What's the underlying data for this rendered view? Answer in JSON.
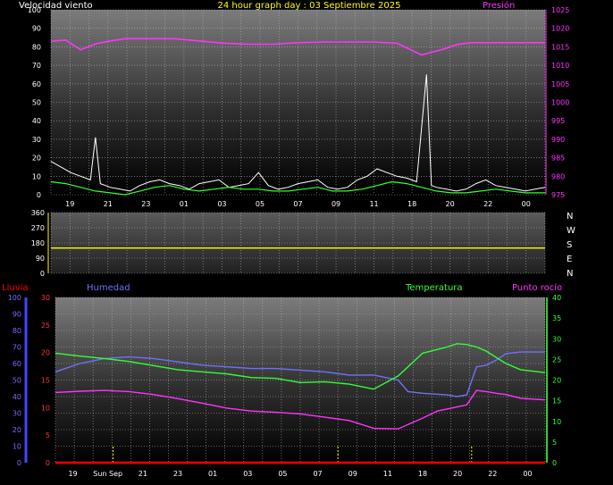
{
  "colors": {
    "background": "#000000",
    "wind_label": "#ffffff",
    "title": "#ffff00",
    "pressure": "#ff33ff",
    "gust": "#ffffff",
    "wind_avg": "#33ff33",
    "direction_line": "#ffff00",
    "rain": "#ff0000",
    "humidity": "#7070ff",
    "temperature": "#33ff33",
    "dewpoint": "#ff33ff",
    "axis_rain": "#4444ff",
    "axis_temp": "#33cc33"
  },
  "header": {
    "wind_label": "Velocidad viento",
    "title": "24 hour graph day : 03 Septiembre 2025",
    "pressure_label": "Presión"
  },
  "compass": [
    "N",
    "W",
    "S",
    "E",
    "N"
  ],
  "bottom_labels": {
    "rain": "Lluvia",
    "humidity": "Humedad",
    "temperature": "Temperatura",
    "dewpoint": "Punto rocío"
  },
  "chart_data": [
    {
      "type": "line",
      "name": "wind_pressure",
      "x_tick_labels": [
        "19",
        "21",
        "23",
        "01",
        "03",
        "05",
        "07",
        "09",
        "11",
        "18",
        "20",
        "22",
        "00"
      ],
      "y_left_ticks": [
        "0",
        "10",
        "20",
        "30",
        "40",
        "50",
        "60",
        "70",
        "80",
        "90",
        "100"
      ],
      "y_right_ticks": [
        "975",
        "980",
        "985",
        "990",
        "995",
        "1000",
        "1005",
        "1010",
        "1015",
        "1020",
        "1025"
      ],
      "ylim_left": [
        0,
        100
      ],
      "ylim_right": [
        975,
        1025
      ],
      "series": [
        {
          "key": "pressure",
          "axis": "right",
          "x": [
            0,
            0.03,
            0.06,
            0.09,
            0.12,
            0.15,
            0.2,
            0.25,
            0.3,
            0.35,
            0.4,
            0.45,
            0.5,
            0.55,
            0.6,
            0.65,
            0.7,
            0.75,
            0.8,
            0.82,
            0.85,
            0.9,
            0.95,
            1
          ],
          "values": [
            1016.5,
            1016.8,
            1014.2,
            1015.8,
            1016.6,
            1017.2,
            1017.2,
            1017.2,
            1016.6,
            1016.0,
            1015.7,
            1015.7,
            1016.1,
            1016.3,
            1016.3,
            1016.3,
            1016.0,
            1012.8,
            1014.6,
            1015.6,
            1016.1,
            1016.1,
            1016.1,
            1016.1
          ]
        },
        {
          "key": "gust",
          "axis": "left",
          "x": [
            0,
            0.02,
            0.04,
            0.06,
            0.08,
            0.09,
            0.1,
            0.12,
            0.14,
            0.16,
            0.18,
            0.2,
            0.22,
            0.24,
            0.26,
            0.28,
            0.3,
            0.32,
            0.34,
            0.36,
            0.38,
            0.4,
            0.42,
            0.44,
            0.46,
            0.48,
            0.5,
            0.52,
            0.54,
            0.56,
            0.58,
            0.6,
            0.62,
            0.64,
            0.66,
            0.68,
            0.7,
            0.72,
            0.74,
            0.76,
            0.77,
            0.78,
            0.8,
            0.82,
            0.84,
            0.86,
            0.88,
            0.9,
            0.92,
            0.94,
            0.96,
            0.98,
            1
          ],
          "values": [
            18,
            15,
            12,
            10,
            8,
            31,
            6,
            4,
            3,
            2,
            5,
            7,
            8,
            6,
            5,
            3,
            6,
            7,
            8,
            4,
            5,
            6,
            12,
            5,
            3,
            4,
            6,
            7,
            8,
            4,
            3,
            4,
            8,
            10,
            14,
            12,
            10,
            9,
            7,
            65,
            5,
            4,
            3,
            2,
            3,
            6,
            8,
            5,
            4,
            3,
            2,
            3,
            4
          ]
        },
        {
          "key": "wind_avg",
          "axis": "left",
          "x": [
            0,
            0.03,
            0.06,
            0.09,
            0.12,
            0.15,
            0.18,
            0.21,
            0.24,
            0.27,
            0.3,
            0.33,
            0.36,
            0.39,
            0.42,
            0.45,
            0.48,
            0.51,
            0.54,
            0.57,
            0.6,
            0.63,
            0.66,
            0.69,
            0.72,
            0.75,
            0.78,
            0.81,
            0.84,
            0.87,
            0.9,
            0.93,
            0.96,
            1
          ],
          "values": [
            7,
            6,
            4,
            2,
            1,
            0,
            2,
            4,
            5,
            3,
            2,
            3,
            4,
            3,
            3,
            2,
            2,
            3,
            4,
            2,
            2,
            3,
            5,
            7,
            6,
            4,
            2,
            1,
            1,
            2,
            3,
            2,
            1,
            1
          ]
        }
      ]
    },
    {
      "type": "line",
      "name": "wind_direction",
      "y_ticks": [
        "0",
        "90",
        "180",
        "270",
        "360"
      ],
      "ylim": [
        0,
        360
      ],
      "series": [
        {
          "key": "direction",
          "x": [
            0,
            1
          ],
          "values": [
            150,
            150
          ]
        }
      ]
    },
    {
      "type": "line",
      "name": "temp_hum",
      "x_tick_labels": [
        "19",
        "Sun Sep",
        "21",
        "23",
        "01",
        "03",
        "05",
        "07",
        "09",
        "11",
        "18",
        "20",
        "22",
        "00"
      ],
      "y_rain_ticks": [
        "0",
        "5",
        "10",
        "15",
        "20",
        "25",
        "30"
      ],
      "y_humidity_ticks": [
        "0",
        "10",
        "20",
        "30",
        "40",
        "50",
        "60",
        "70",
        "80",
        "90",
        "100"
      ],
      "y_temp_ticks": [
        "0",
        "5",
        "10",
        "15",
        "20",
        "25",
        "30",
        "35",
        "40"
      ],
      "ylim_rain": [
        0,
        30
      ],
      "ylim_humidity": [
        0,
        100
      ],
      "ylim_temp": [
        0,
        40
      ],
      "series": [
        {
          "key": "humidity",
          "axis": "humidity",
          "x": [
            0,
            0.05,
            0.1,
            0.15,
            0.2,
            0.25,
            0.3,
            0.35,
            0.4,
            0.45,
            0.5,
            0.55,
            0.6,
            0.65,
            0.7,
            0.72,
            0.75,
            0.8,
            0.82,
            0.84,
            0.86,
            0.88,
            0.9,
            0.92,
            0.95,
            1
          ],
          "values": [
            55,
            60,
            63,
            64,
            63,
            61,
            59,
            58,
            57,
            57,
            56,
            55,
            53,
            53,
            50,
            43,
            42,
            41,
            40,
            41,
            58,
            59,
            62,
            66,
            67,
            67
          ]
        },
        {
          "key": "temperature",
          "axis": "temp",
          "x": [
            0,
            0.05,
            0.1,
            0.15,
            0.2,
            0.25,
            0.3,
            0.35,
            0.4,
            0.45,
            0.5,
            0.55,
            0.6,
            0.65,
            0.7,
            0.75,
            0.8,
            0.82,
            0.84,
            0.86,
            0.88,
            0.9,
            0.92,
            0.95,
            1
          ],
          "values": [
            26.5,
            25.8,
            25.2,
            24.5,
            23.5,
            22.5,
            22,
            21.5,
            20.6,
            20.4,
            19.4,
            19.6,
            19,
            17.8,
            21,
            26.5,
            28,
            28.8,
            28.6,
            28,
            27,
            25.5,
            24,
            22.5,
            21.8
          ]
        },
        {
          "key": "dewpoint",
          "axis": "temp",
          "x": [
            0,
            0.05,
            0.1,
            0.15,
            0.2,
            0.25,
            0.3,
            0.35,
            0.4,
            0.45,
            0.5,
            0.55,
            0.6,
            0.65,
            0.7,
            0.75,
            0.78,
            0.8,
            0.82,
            0.84,
            0.86,
            0.88,
            0.9,
            0.92,
            0.95,
            1
          ],
          "values": [
            17,
            17.3,
            17.5,
            17.2,
            16.5,
            15.5,
            14.4,
            13.2,
            12.5,
            12.2,
            11.8,
            11,
            10.2,
            8.3,
            8.2,
            10.8,
            12.5,
            13,
            13.5,
            14,
            17.5,
            17.2,
            16.8,
            16.5,
            15.6,
            15.2
          ]
        },
        {
          "key": "rain",
          "axis": "rain",
          "x": [
            0,
            1
          ],
          "values": [
            0,
            0
          ]
        }
      ]
    }
  ]
}
